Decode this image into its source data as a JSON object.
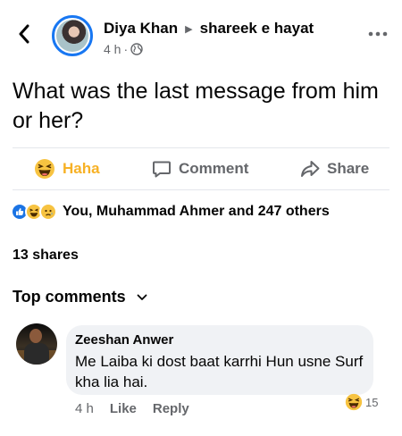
{
  "post": {
    "author": "Diya Khan",
    "group": "shareek e hayat",
    "time": "4 h",
    "privacy_icon": "globe-icon",
    "text": "What was the last message from him or her?"
  },
  "actions": {
    "haha_label": "Haha",
    "comment_label": "Comment",
    "share_label": "Share"
  },
  "reactions": {
    "icons": [
      "like-icon",
      "haha-icon",
      "sad-icon"
    ],
    "summary": "You, Muhammad Ahmer and 247 others"
  },
  "shares_text": "13 shares",
  "comments_header": "Top comments",
  "comment": {
    "author": "Zeeshan Anwer",
    "text": "Me Laiba ki dost baat karrhi Hun usne Surf kha lia hai.",
    "time": "4 h",
    "like_label": "Like",
    "reply_label": "Reply",
    "reaction_icon": "haha-icon",
    "reaction_count": "15"
  },
  "colors": {
    "brand_blue": "#1877f2",
    "haha_yellow": "#f7b125",
    "muted_text": "#65676b",
    "bubble_bg": "#f0f2f5"
  }
}
